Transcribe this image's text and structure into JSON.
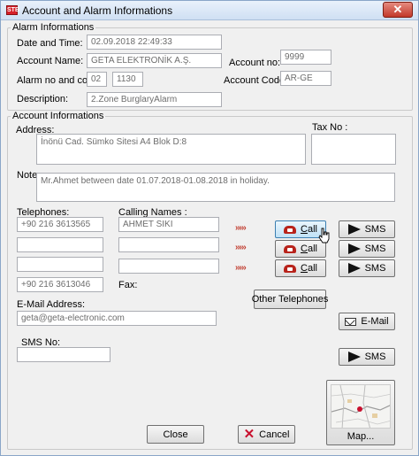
{
  "window": {
    "title": "Account and Alarm Informations",
    "app_icon_text": "STB",
    "close_glyph": "✕"
  },
  "alarm_group": {
    "legend": "Alarm Informations",
    "date_label": "Date and Time:",
    "date_value": "02.09.2018 22:49:33",
    "account_name_label": "Account Name:",
    "account_name_value": "GETA ELEKTRONİK A.Ş.",
    "account_no_label": "Account no:",
    "account_no_value": "9999",
    "alarm_no_label": "Alarm no and code:",
    "alarm_no_value": "02",
    "alarm_code_value": "1130",
    "account_code_label": "Account Code:",
    "account_code_value": "AR-GE",
    "description_label": "Description:",
    "description_value": "2.Zone BurglaryAlarm"
  },
  "account_group": {
    "legend": "Account Informations",
    "address_label": "Address:",
    "address_value": "İnönü Cad. Sümko Sitesi A4 Blok D:8",
    "tax_label": "Tax No :",
    "tax_value": "",
    "note_label": "Note:",
    "note_value": "Mr.Ahmet between date 01.07.2018-01.08.2018 in holiday.",
    "telephones_label": "Telephones:",
    "calling_names_label": "Calling Names :",
    "phones": [
      "+90 216 3613565",
      "",
      ""
    ],
    "calling_names": [
      "AHMET SIKI",
      "",
      ""
    ],
    "arrows": "›››››",
    "fax_value": "+90 216 3613046",
    "fax_label": "Fax:",
    "other_telephones_label": "Other Telephones",
    "email_label": "E-Mail Address:",
    "email_value": "geta@geta-electronic.com",
    "email_button_label": "E-Mail",
    "sms_no_label": "SMS No:",
    "sms_no_value": ""
  },
  "buttons": {
    "call_label": "Call",
    "sms_label": "SMS",
    "close_label": "Close",
    "cancel_label": "Cancel",
    "map_label": "Map..."
  },
  "colors": {
    "accent": "#3c7fb1",
    "arrow_red": "#c0392b",
    "cancel_red": "#c8102e"
  }
}
